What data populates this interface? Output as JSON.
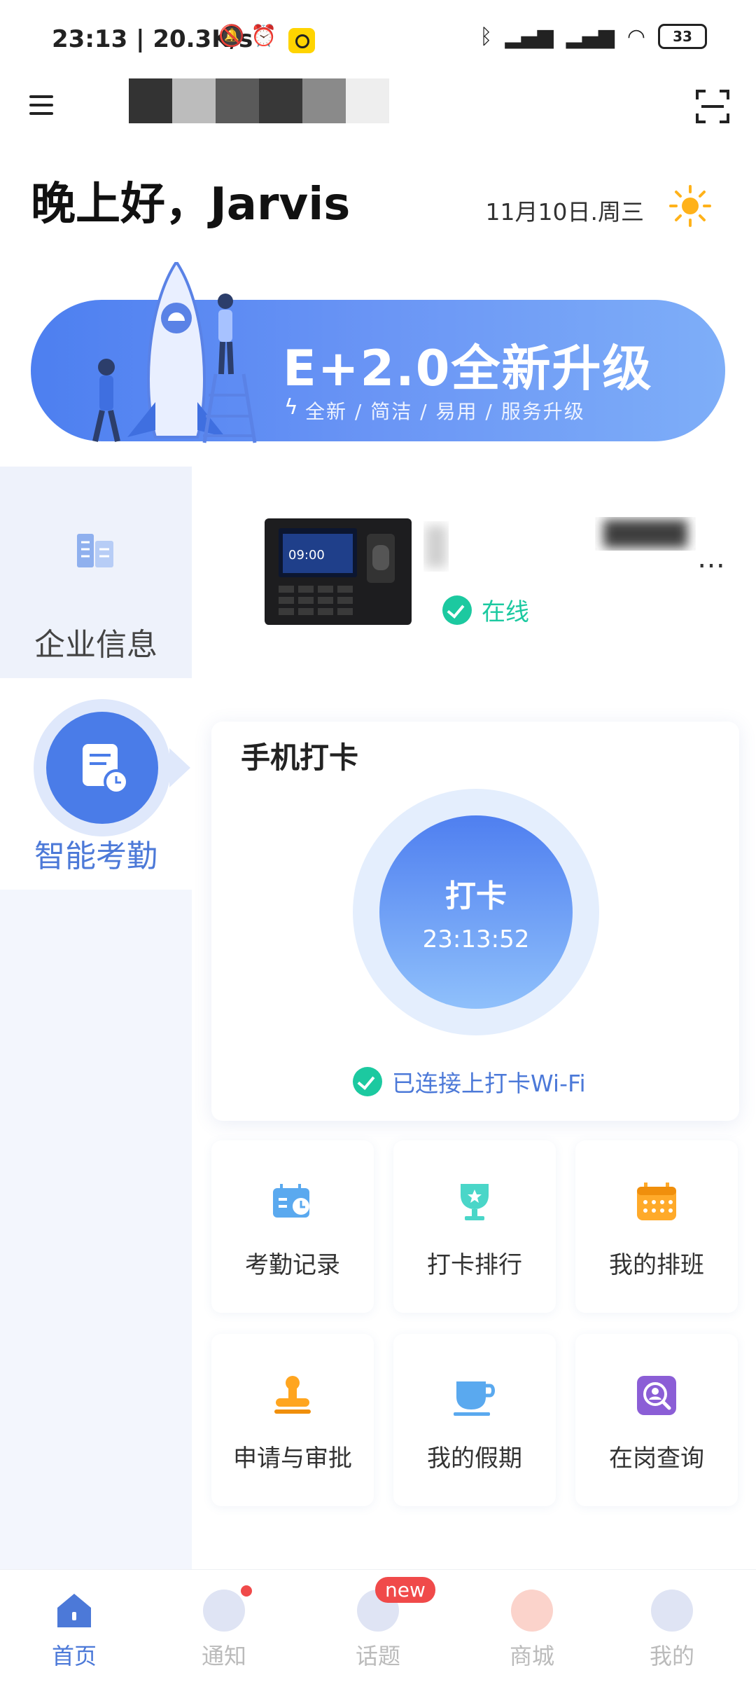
{
  "status_bar": {
    "time": "23:13 | 20.3K/s",
    "battery": "33"
  },
  "header": {
    "greeting": "晚上好，Jarvis",
    "date": "11月10日.周三"
  },
  "banner": {
    "title": "E+2.0全新升级",
    "subtitle": "全新 / 简洁 / 易用 / 服务升级"
  },
  "sidebar": {
    "items": [
      {
        "label": "企业信息"
      },
      {
        "label": "智能考勤"
      }
    ]
  },
  "device": {
    "screen_time": "09:00",
    "status": "在线"
  },
  "punch": {
    "title": "手机打卡",
    "button_label": "打卡",
    "time": "23:13:52",
    "wifi_status": "已连接上打卡Wi-Fi"
  },
  "features": [
    {
      "label": "考勤记录",
      "icon": "calendar-clock-icon"
    },
    {
      "label": "打卡排行",
      "icon": "trophy-icon"
    },
    {
      "label": "我的排班",
      "icon": "calendar-grid-icon"
    },
    {
      "label": "申请与审批",
      "icon": "stamp-icon"
    },
    {
      "label": "我的假期",
      "icon": "cup-icon"
    },
    {
      "label": "在岗查询",
      "icon": "person-search-icon"
    }
  ],
  "bottom_nav": [
    {
      "label": "首页"
    },
    {
      "label": "通知"
    },
    {
      "label": "话题",
      "badge": "new"
    },
    {
      "label": "商城"
    },
    {
      "label": "我的"
    }
  ],
  "colors": {
    "accent": "#4c79d8",
    "online": "#1cc9a0",
    "badge": "#f04a4a"
  }
}
